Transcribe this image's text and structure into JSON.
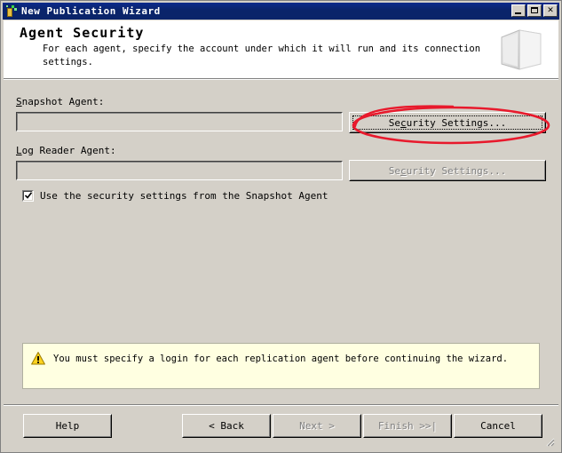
{
  "window": {
    "title": "New Publication Wizard",
    "icon": "wizard-bottle-icon",
    "controls": {
      "minimize": "minimize-button",
      "maximize": "maximize-button",
      "close": "✕"
    }
  },
  "header": {
    "title": "Agent Security",
    "subtitle": "For each agent, specify the account under which it will run and its connection settings.",
    "icon": "wizard-book-icon"
  },
  "form": {
    "snapshot_agent": {
      "label_pre": "",
      "label_accel": "S",
      "label_post": "napshot Agent:",
      "label_full": "Snapshot Agent:",
      "value": "",
      "placeholder": ""
    },
    "log_reader_agent": {
      "label_accel": "L",
      "label_post": "og Reader Agent:",
      "label_full": "Log Reader Agent:",
      "value": "",
      "placeholder": ""
    },
    "security_settings_primary": {
      "pre": "Se",
      "accel": "c",
      "post": "urity Settings...",
      "full": "Security Settings...",
      "state": "enabled-focused"
    },
    "security_settings_secondary": {
      "pre": "Se",
      "accel": "c",
      "post": "urity Settings...",
      "full": "Security Settings...",
      "state": "disabled"
    },
    "reuse_checkbox": {
      "label": "Use the security settings from the Snapshot Agent",
      "checked": true
    }
  },
  "warning": {
    "icon": "warning-triangle-icon",
    "text": "You must specify a login for each replication agent before continuing the wizard."
  },
  "footer": {
    "help": "Help",
    "back": "< Back",
    "next": "Next >",
    "finish": "Finish >>|",
    "cancel": "Cancel",
    "next_state": "disabled",
    "finish_state": "disabled"
  },
  "annotation": {
    "type": "red-ellipse",
    "color": "#e8192c",
    "target": "security-settings-primary-button"
  },
  "colors": {
    "window_face": "#d4d0c8",
    "titlebar": "#0a246a",
    "warning_bg": "#ffffe1",
    "annotation_red": "#e8192c"
  }
}
